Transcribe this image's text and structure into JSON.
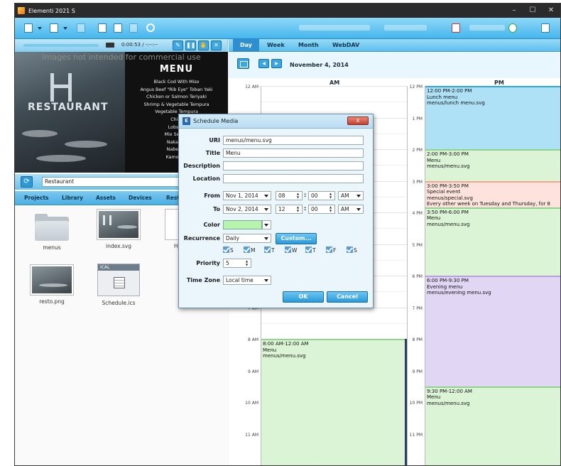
{
  "window": {
    "title": "Elementi 2021 S",
    "controls": {
      "minimize": "–",
      "maximize": "☐",
      "close": "✕"
    }
  },
  "player": {
    "time": "0:00:53 / -:--:--"
  },
  "preview": {
    "watermark": "Images not intended for commercial use",
    "logo_text": "RESTAURANT",
    "menu_title": "MENU",
    "menu_items": [
      "Black Cod With Miso",
      "Angus Beef \"Rib Eye\" Toban Yaki",
      "Chicken or Salmon Teriyaki",
      "Shrimp & Vegetable Tempura",
      "Vegetable Tempura",
      "Chira",
      "Lobster",
      "Mix Seawe",
      "Nakaoch",
      "Nabeyak",
      "Kamonan"
    ]
  },
  "library": {
    "path": "Restaurant",
    "tabs": [
      "Projects",
      "Library",
      "Assets",
      "Devices",
      "Resta"
    ],
    "files": [
      {
        "name": "menus",
        "kind": "folder"
      },
      {
        "name": "index.svg",
        "kind": "image"
      },
      {
        "name": "H_le",
        "kind": "image"
      },
      {
        "name": "resto.png",
        "kind": "image"
      },
      {
        "name": "Schedule.ics",
        "kind": "ics",
        "badge": "ICAL"
      }
    ]
  },
  "calendar": {
    "tabs": [
      "Day",
      "Week",
      "Month",
      "WebDAV"
    ],
    "active_tab": "Day",
    "date": "November 4, 2014",
    "am_label": "AM",
    "pm_label": "PM",
    "am_hours": [
      "12 AM",
      "1 AM",
      "2 AM",
      "3 AM",
      "4 AM",
      "5 AM",
      "6 AM",
      "7 AM",
      "8 AM",
      "9 AM",
      "10 AM",
      "11 AM"
    ],
    "pm_hours": [
      "12 PM",
      "1 PM",
      "2 PM",
      "3 PM",
      "4 PM",
      "5 PM",
      "6 PM",
      "7 PM",
      "8 PM",
      "9 PM",
      "10 PM",
      "11 PM"
    ],
    "am_events": [
      {
        "time": "8:00 AM-12:00 AM",
        "title": "Menu",
        "uri": "menus/menu.svg",
        "color": "green"
      }
    ],
    "pm_events": [
      {
        "time": "12:00 PM-2:00 PM",
        "title": "Lunch menu",
        "uri": "menus/lunch menu.svg",
        "color": "blue"
      },
      {
        "time": "2:00 PM-3:00 PM",
        "title": "Menu",
        "uri": "menus/menu.svg",
        "color": "green"
      },
      {
        "time": "3:00 PM-3:50 PM",
        "title": "Special event",
        "uri": "menus/special.svg",
        "note": "Every other week on Tuesday and Thursday, for 8",
        "color": "pink"
      },
      {
        "time": "3:50 PM-6:00 PM",
        "title": "Menu",
        "uri": "menus/menu.svg",
        "color": "green"
      },
      {
        "time": "6:00 PM-9:30 PM",
        "title": "Evening menu",
        "uri": "menus/evening menu.svg",
        "color": "purple"
      },
      {
        "time": "9:30 PM-12:00 AM",
        "title": "Menu",
        "uri": "menus/menu.svg",
        "color": "green"
      }
    ]
  },
  "dialog": {
    "title": "Schedule Media",
    "close_label": "x",
    "labels": {
      "uri": "URI",
      "title": "Title",
      "description": "Description",
      "location": "Location",
      "from": "From",
      "to": "To",
      "color": "Color",
      "recurrence": "Recurrence",
      "priority": "Priority",
      "timezone": "Time Zone"
    },
    "values": {
      "uri": "menus/menu.svg",
      "title": "Menu",
      "description": "",
      "location": "",
      "from_date": "Nov 1, 2014",
      "from_hour": "08",
      "from_min": "00",
      "from_ampm": "AM",
      "to_date": "Nov 2, 2014",
      "to_hour": "12",
      "to_min": "00",
      "to_ampm": "AM",
      "recurrence": "Daily",
      "priority": "5",
      "timezone": "Local time"
    },
    "color_value": "#b8f4ad",
    "custom_button": "Custom...",
    "days": [
      "S",
      "M",
      "T",
      "W",
      "T",
      "F",
      "S"
    ],
    "ok": "OK",
    "cancel": "Cancel"
  }
}
